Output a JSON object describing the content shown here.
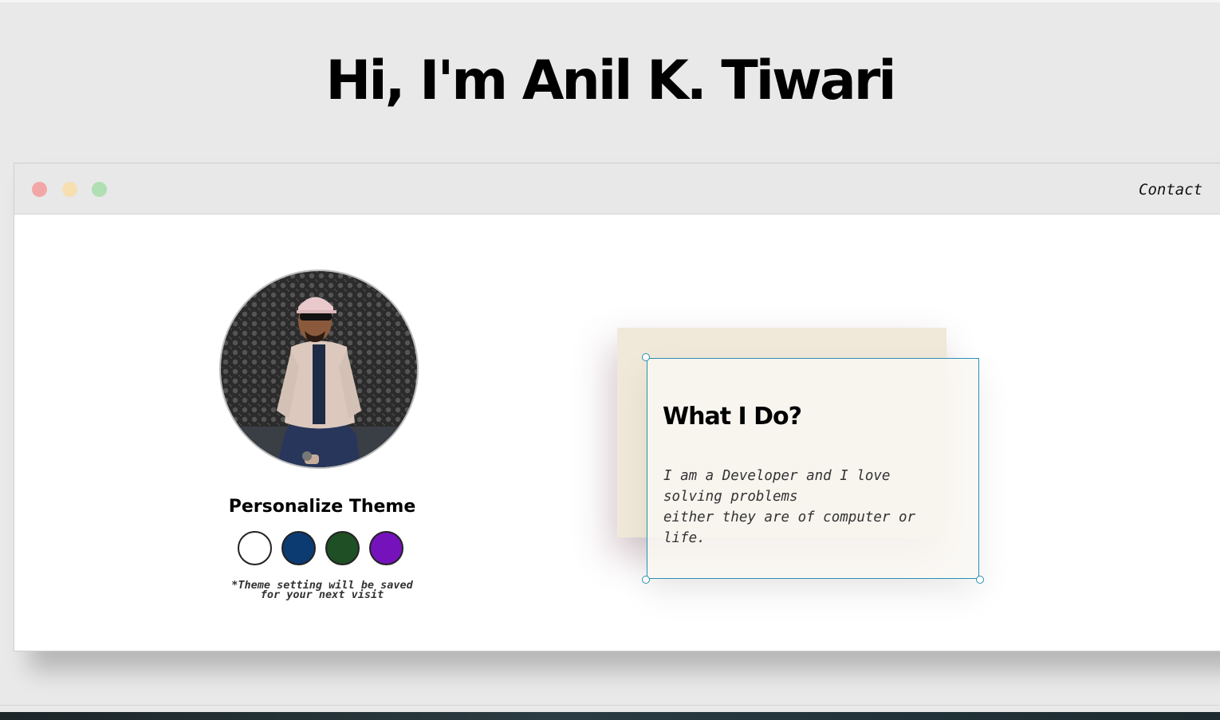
{
  "hero": {
    "title": "Hi, I'm Anil K. Tiwari"
  },
  "window": {
    "controls": [
      "close-dot",
      "minimize-dot",
      "maximize-dot"
    ],
    "nav": {
      "contact_label": "Contact"
    }
  },
  "profile": {
    "photo_alt": "Profile photo",
    "theme_title": "Personalize Theme",
    "swatches": [
      {
        "name": "white",
        "color": "#ffffff"
      },
      {
        "name": "blue",
        "color": "#0c3b72"
      },
      {
        "name": "green",
        "color": "#1f4f24"
      },
      {
        "name": "purple",
        "color": "#7512bb"
      }
    ],
    "theme_note": "*Theme setting will be saved\nfor your next visit"
  },
  "card": {
    "heading": "What I Do?",
    "text": "I am a Developer and I love\nsolving problems\neither they are of computer or\nlife."
  }
}
